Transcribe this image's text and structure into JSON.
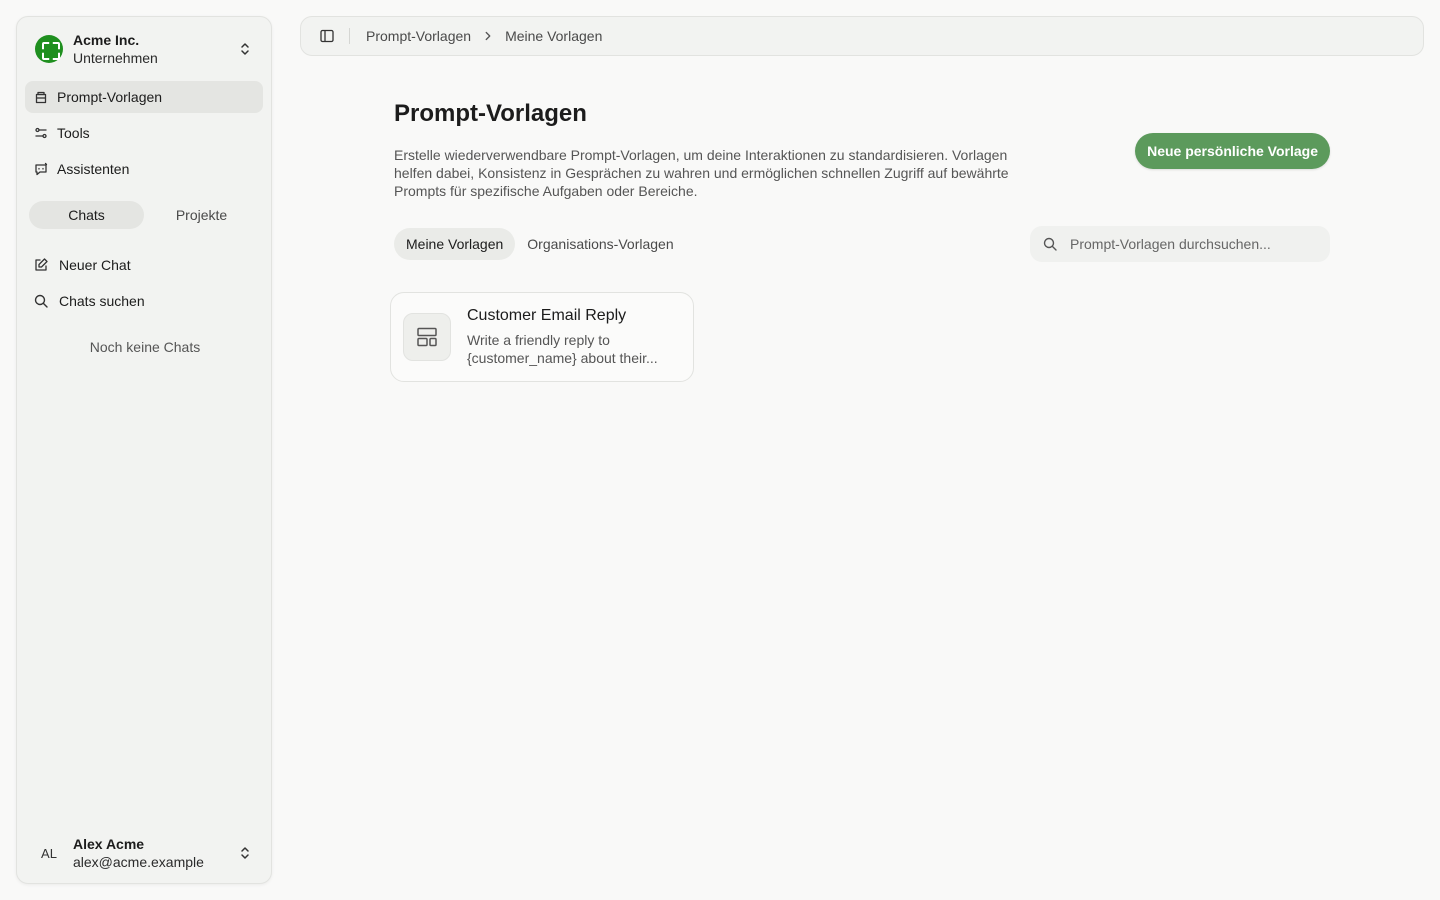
{
  "sidebar": {
    "org": {
      "name": "Acme Inc.",
      "type": "Unternehmen"
    },
    "nav": [
      {
        "label": "Prompt-Vorlagen",
        "icon": "stack-icon",
        "active": true
      },
      {
        "label": "Tools",
        "icon": "sliders-icon",
        "active": false
      },
      {
        "label": "Assistenten",
        "icon": "bot-icon",
        "active": false
      }
    ],
    "segments": {
      "chats": "Chats",
      "projects": "Projekte"
    },
    "actions": {
      "new_chat": "Neuer Chat",
      "search_chats": "Chats suchen"
    },
    "empty_text": "Noch keine Chats",
    "user": {
      "initials": "AL",
      "name": "Alex Acme",
      "email": "alex@acme.example"
    }
  },
  "breadcrumb": {
    "root": "Prompt-Vorlagen",
    "current": "Meine Vorlagen"
  },
  "main": {
    "title": "Prompt-Vorlagen",
    "description": "Erstelle wiederverwendbare Prompt-Vorlagen, um deine Interaktionen zu standardisieren. Vorlagen helfen dabei, Konsistenz in Gesprächen zu wahren und ermöglichen schnellen Zugriff auf bewährte Prompts für spezifische Aufgaben oder Bereiche.",
    "new_button": "Neue persönliche Vorlage",
    "tabs": {
      "mine": "Meine Vorlagen",
      "org": "Organisations-Vorlagen"
    },
    "search_placeholder": "Prompt-Vorlagen durchsuchen...",
    "cards": [
      {
        "title": "Customer Email Reply",
        "description": "Write a friendly reply to {customer_name} about their..."
      }
    ]
  },
  "colors": {
    "accent": "#5c9a5c",
    "org_logo": "#1f8f1f"
  }
}
